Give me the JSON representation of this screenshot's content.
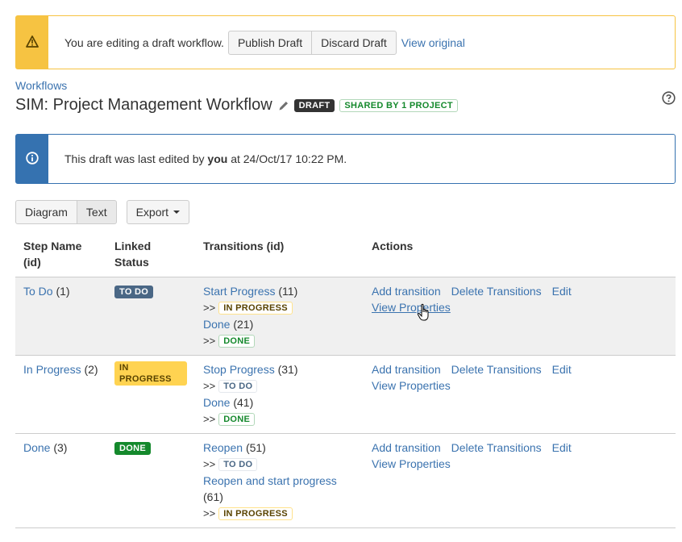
{
  "warning": {
    "message": "You are editing a draft workflow.",
    "publish_label": "Publish Draft",
    "discard_label": "Discard Draft",
    "view_original_label": "View original",
    "color": "#f6c342"
  },
  "header": {
    "breadcrumb": "Workflows",
    "title": "SIM: Project Management Workflow",
    "draft_badge": "DRAFT",
    "shared_badge": "SHARED BY 1 PROJECT"
  },
  "info": {
    "prefix": "This draft was last edited by ",
    "user": "you",
    "suffix": " at 24/Oct/17 10:22 PM.",
    "color": "#3572b0"
  },
  "toolbar": {
    "diagram_label": "Diagram",
    "text_label": "Text",
    "export_label": "Export",
    "active_view": "Text"
  },
  "table": {
    "headers": {
      "step_line1": "Step Name",
      "step_line2": "(id)",
      "status_line1": "Linked",
      "status_line2": "Status",
      "transitions": "Transitions (id)",
      "actions": "Actions"
    },
    "actions": {
      "add": "Add transition",
      "delete": "Delete Transitions",
      "edit": "Edit",
      "view": "View Properties"
    },
    "arrow": ">>",
    "rows": [
      {
        "step": "To Do",
        "step_id": "(1)",
        "status": "TO DO",
        "transitions": [
          {
            "name": "Start Progress",
            "id": "(11)",
            "target": "IN PROGRESS"
          },
          {
            "name": "Done",
            "id": "(21)",
            "target": "DONE"
          }
        ]
      },
      {
        "step": "In Progress",
        "step_id": "(2)",
        "status": "IN PROGRESS",
        "transitions": [
          {
            "name": "Stop Progress",
            "id": "(31)",
            "target": "TO DO"
          },
          {
            "name": "Done",
            "id": "(41)",
            "target": "DONE"
          }
        ]
      },
      {
        "step": "Done",
        "step_id": "(3)",
        "status": "DONE",
        "transitions": [
          {
            "name": "Reopen",
            "id": "(51)",
            "target": "TO DO"
          },
          {
            "name": "Reopen and start progress",
            "id": "(61)",
            "target": "IN PROGRESS"
          }
        ]
      }
    ]
  },
  "icons": {
    "warning": "warning-icon",
    "info": "info-icon",
    "edit": "pencil-icon",
    "help": "help-icon",
    "cursor": "hand-pointer-icon"
  }
}
